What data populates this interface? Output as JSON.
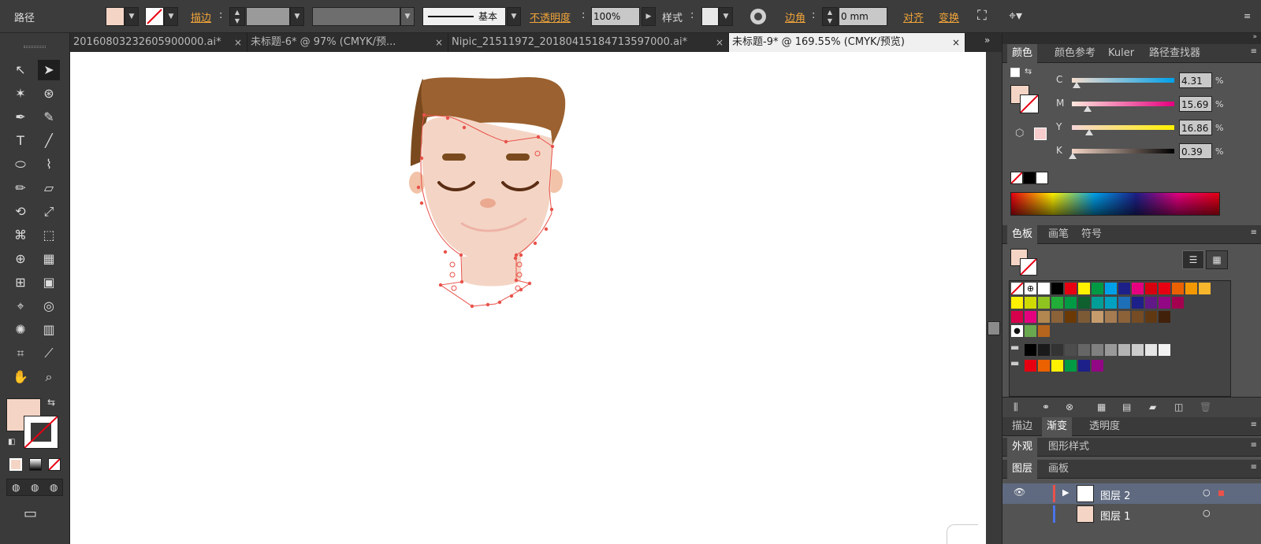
{
  "control_bar": {
    "object_type": "路径",
    "stroke_label": "描边",
    "stroke_style": "基本",
    "opacity_label": "不透明度",
    "opacity_value": "100%",
    "style_label": "样式",
    "corner_label": "边角",
    "corner_value": "0 mm",
    "align_label": "对齐",
    "transform_label": "变换",
    "fill_color": "#f4d5c5"
  },
  "tabs": [
    {
      "label": "20160803232605900000.ai*"
    },
    {
      "label": "未标题-6* @ 97% (CMYK/预..."
    },
    {
      "label": "Nipic_21511972_20180415184713597000.ai*"
    },
    {
      "label": "未标题-9* @ 169.55% (CMYK/预览)"
    }
  ],
  "tab_close": "×",
  "color_panel": {
    "tabs": [
      "颜色",
      "颜色参考",
      "Kuler",
      "路径查找器"
    ],
    "channels": [
      {
        "name": "C",
        "value": "4.31",
        "pos": 4.31
      },
      {
        "name": "M",
        "value": "15.69",
        "pos": 15.69
      },
      {
        "name": "Y",
        "value": "16.86",
        "pos": 16.86
      },
      {
        "name": "K",
        "value": "0.39",
        "pos": 0.39
      }
    ],
    "percent": "%"
  },
  "swatches_panel": {
    "tabs": [
      "色板",
      "画笔",
      "符号"
    ],
    "row1": [
      "#ffffff",
      "#000000",
      "#e60012",
      "#fff100",
      "#009944",
      "#00a0e9",
      "#1d2088",
      "#e4007f",
      "#d7000f",
      "#e60012",
      "#eb6100",
      "#f39800",
      "#f8b62d"
    ],
    "row2": [
      "#fff100",
      "#cfdb00",
      "#8fc31f",
      "#22ac38",
      "#009944",
      "#0f5f2f",
      "#009e96",
      "#00a0c1",
      "#1d6fb8",
      "#1d2088",
      "#601986",
      "#920783",
      "#a40050"
    ],
    "row3": [
      "#d7004b",
      "#e5007f",
      "#b28850",
      "#8c6239",
      "#6a3906",
      "#7d5a36",
      "#c69c6d",
      "#a67c52",
      "#8c6239",
      "#754c24",
      "#603913",
      "#42210b"
    ],
    "gray_row": [
      "#000000",
      "#1a1a1a",
      "#333333",
      "#4d4d4d",
      "#666666",
      "#808080",
      "#999999",
      "#b3b3b3",
      "#cccccc",
      "#e6e6e6",
      "#f2f2f2"
    ],
    "bright_row": [
      "#e60012",
      "#eb6100",
      "#fff100",
      "#009944",
      "#1d2088",
      "#920783"
    ]
  },
  "gradient_panel": {
    "tabs": [
      "描边",
      "渐变",
      "透明度"
    ]
  },
  "appearance_panel": {
    "tabs": [
      "外观",
      "图形样式"
    ]
  },
  "layers_panel": {
    "tabs": [
      "图层",
      "画板"
    ],
    "layers": [
      {
        "name": "图层 2"
      },
      {
        "name": "图层 1"
      }
    ]
  }
}
